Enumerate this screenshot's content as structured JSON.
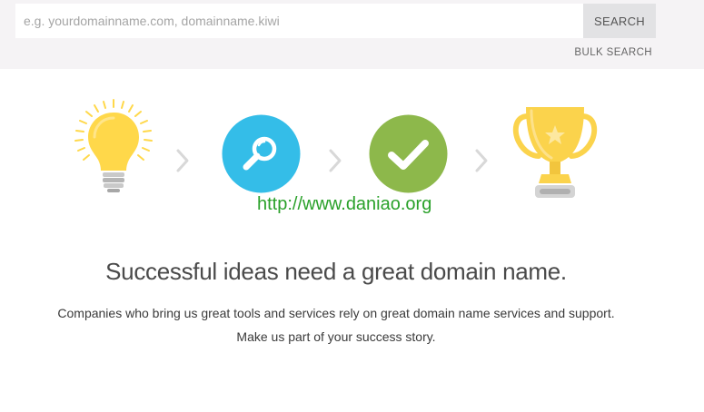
{
  "search": {
    "placeholder": "e.g. yourdomainname.com, domainname.kiwi",
    "value": "",
    "button_label": "SEARCH",
    "bulk_label": "BULK SEARCH"
  },
  "steps": [
    {
      "icon": "lightbulb-icon",
      "color": "#ffd84a"
    },
    {
      "icon": "magnifier-icon",
      "color": "#34bde8"
    },
    {
      "icon": "checkmark-icon",
      "color": "#8db84b"
    },
    {
      "icon": "trophy-icon",
      "color": "#fbd34c"
    }
  ],
  "watermark": "http://www.daniao.org",
  "headline": "Successful ideas need a great domain name.",
  "body": {
    "line1": "Companies who bring us great tools and services rely on great domain name services and support.",
    "line2": "Make us part of your success story."
  }
}
